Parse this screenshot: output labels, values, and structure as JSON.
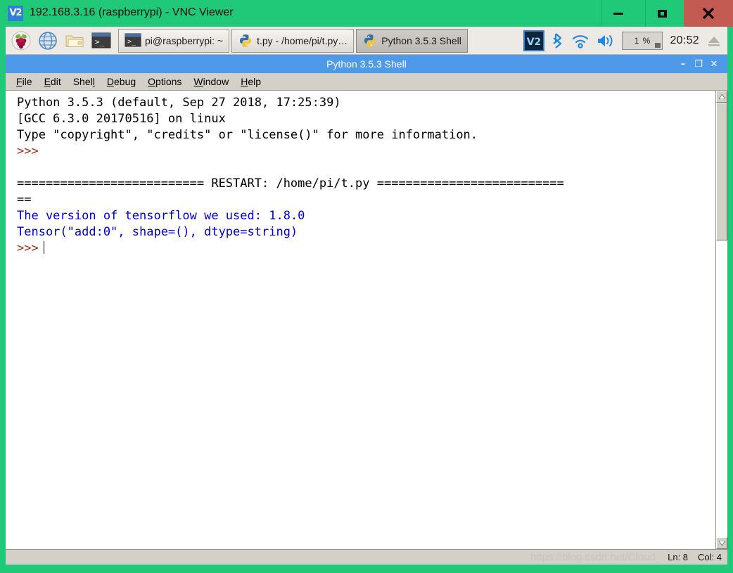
{
  "vnc_window": {
    "logo_text": "V2",
    "title": "192.168.3.16 (raspberrypi) - VNC Viewer",
    "controls": {
      "minimize": "minimize-icon",
      "maximize": "maximize-icon",
      "close": "close-icon"
    },
    "accent_green": "#20c977",
    "close_red": "#c35b52"
  },
  "taskbar": {
    "launchers": [
      {
        "name": "raspberry-menu-icon",
        "label": "Menu"
      },
      {
        "name": "web-browser-icon",
        "label": "Web Browser"
      },
      {
        "name": "file-manager-icon",
        "label": "File Manager"
      },
      {
        "name": "terminal-icon",
        "label": "Terminal"
      }
    ],
    "windows": [
      {
        "name": "taskbar-window-terminal",
        "icon": "terminal-icon",
        "label": "pi@raspberrypi: ~",
        "active": false
      },
      {
        "name": "taskbar-window-editor",
        "icon": "python-icon",
        "label": "t.py - /home/pi/t.py…",
        "active": false
      },
      {
        "name": "taskbar-window-shell",
        "icon": "python-icon",
        "label": "Python 3.5.3 Shell",
        "active": true
      }
    ],
    "tray": {
      "vnc_icon": "vnc-server-icon",
      "bluetooth_icon": "bluetooth-icon",
      "wifi_icon": "wifi-icon",
      "volume_icon": "volume-icon",
      "cpu_label": "1 %",
      "clock": "20:52",
      "eject_icon": "eject-icon"
    }
  },
  "idle_window": {
    "title": "Python 3.5.3 Shell",
    "controls": {
      "minimize": "–",
      "maximize": "❐",
      "close": "✕"
    },
    "menus": [
      {
        "name": "menu-file",
        "before": "",
        "accel": "F",
        "after": "ile"
      },
      {
        "name": "menu-edit",
        "before": "",
        "accel": "E",
        "after": "dit"
      },
      {
        "name": "menu-shell",
        "before": "Shel",
        "accel": "l",
        "after": ""
      },
      {
        "name": "menu-debug",
        "before": "",
        "accel": "D",
        "after": "ebug"
      },
      {
        "name": "menu-options",
        "before": "",
        "accel": "O",
        "after": "ptions"
      },
      {
        "name": "menu-window",
        "before": "",
        "accel": "W",
        "after": "indow"
      },
      {
        "name": "menu-help",
        "before": "",
        "accel": "H",
        "after": "elp"
      }
    ],
    "shell_lines": [
      {
        "segments": [
          {
            "text": "Python 3.5.3 (default, Sep 27 2018, 17:25:39)",
            "color": "black"
          }
        ]
      },
      {
        "segments": [
          {
            "text": "[GCC 6.3.0 20170516] on linux",
            "color": "black"
          }
        ]
      },
      {
        "segments": [
          {
            "text": "Type \"copyright\", \"credits\" or \"license()\" for more information.",
            "color": "black"
          }
        ]
      },
      {
        "segments": [
          {
            "text": ">>>",
            "color": "prompt"
          }
        ]
      },
      {
        "segments": [
          {
            "text": "",
            "color": "black"
          }
        ]
      },
      {
        "segments": [
          {
            "text": "========================== RESTART: /home/pi/t.py ==========================",
            "color": "black"
          }
        ]
      },
      {
        "segments": [
          {
            "text": "==",
            "color": "black"
          }
        ]
      },
      {
        "segments": [
          {
            "text": "The version of tensorflow we used: 1.8.0",
            "color": "out"
          }
        ]
      },
      {
        "segments": [
          {
            "text": "Tensor(\"add:0\", shape=(), dtype=string)",
            "color": "out"
          }
        ]
      },
      {
        "segments": [
          {
            "text": ">>>",
            "color": "prompt"
          },
          {
            "text": "",
            "color": "caret"
          }
        ]
      }
    ],
    "statusbar": {
      "watermark": "https://blog.csdn.net/Cloud_",
      "line_label": "Ln: 8",
      "col_label": "Col: 4"
    },
    "scrollbar": {
      "up_arrow": "scroll-up-icon",
      "down_arrow": "scroll-down-icon"
    }
  }
}
